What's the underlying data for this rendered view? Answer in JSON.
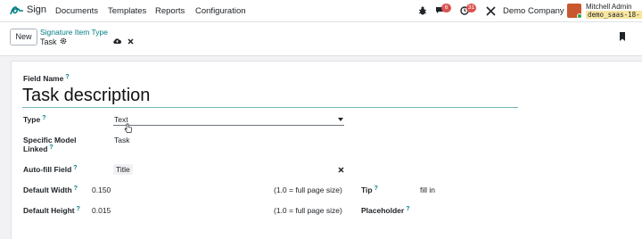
{
  "navbar": {
    "app_name": "Sign",
    "menu": [
      "Documents",
      "Templates",
      "Reports",
      "Configuration"
    ],
    "messages_badge": "6",
    "activities_badge": "31",
    "company": "Demo Company",
    "user_name": "Mitchell Admin",
    "db_name": "demo_saas-18-"
  },
  "control": {
    "new_label": "New",
    "breadcrumb_parent": "Signature Item Type",
    "breadcrumb_current": "Task"
  },
  "form": {
    "field_name_label": "Field Name",
    "field_name_value": "Task description",
    "type_label": "Type",
    "type_value": "Text",
    "model_label_1": "Specific Model",
    "model_label_2": "Linked",
    "model_value": "Task",
    "autofill_label": "Auto-fill Field",
    "autofill_value": "Title",
    "width_label": "Default Width",
    "width_value": "0.150",
    "width_hint": "(1.0 = full page size)",
    "height_label": "Default Height",
    "height_value": "0.015",
    "height_hint": "(1.0 = full page size)",
    "tip_label": "Tip",
    "tip_value": "fill in",
    "placeholder_label": "Placeholder",
    "help_mark": "?"
  }
}
